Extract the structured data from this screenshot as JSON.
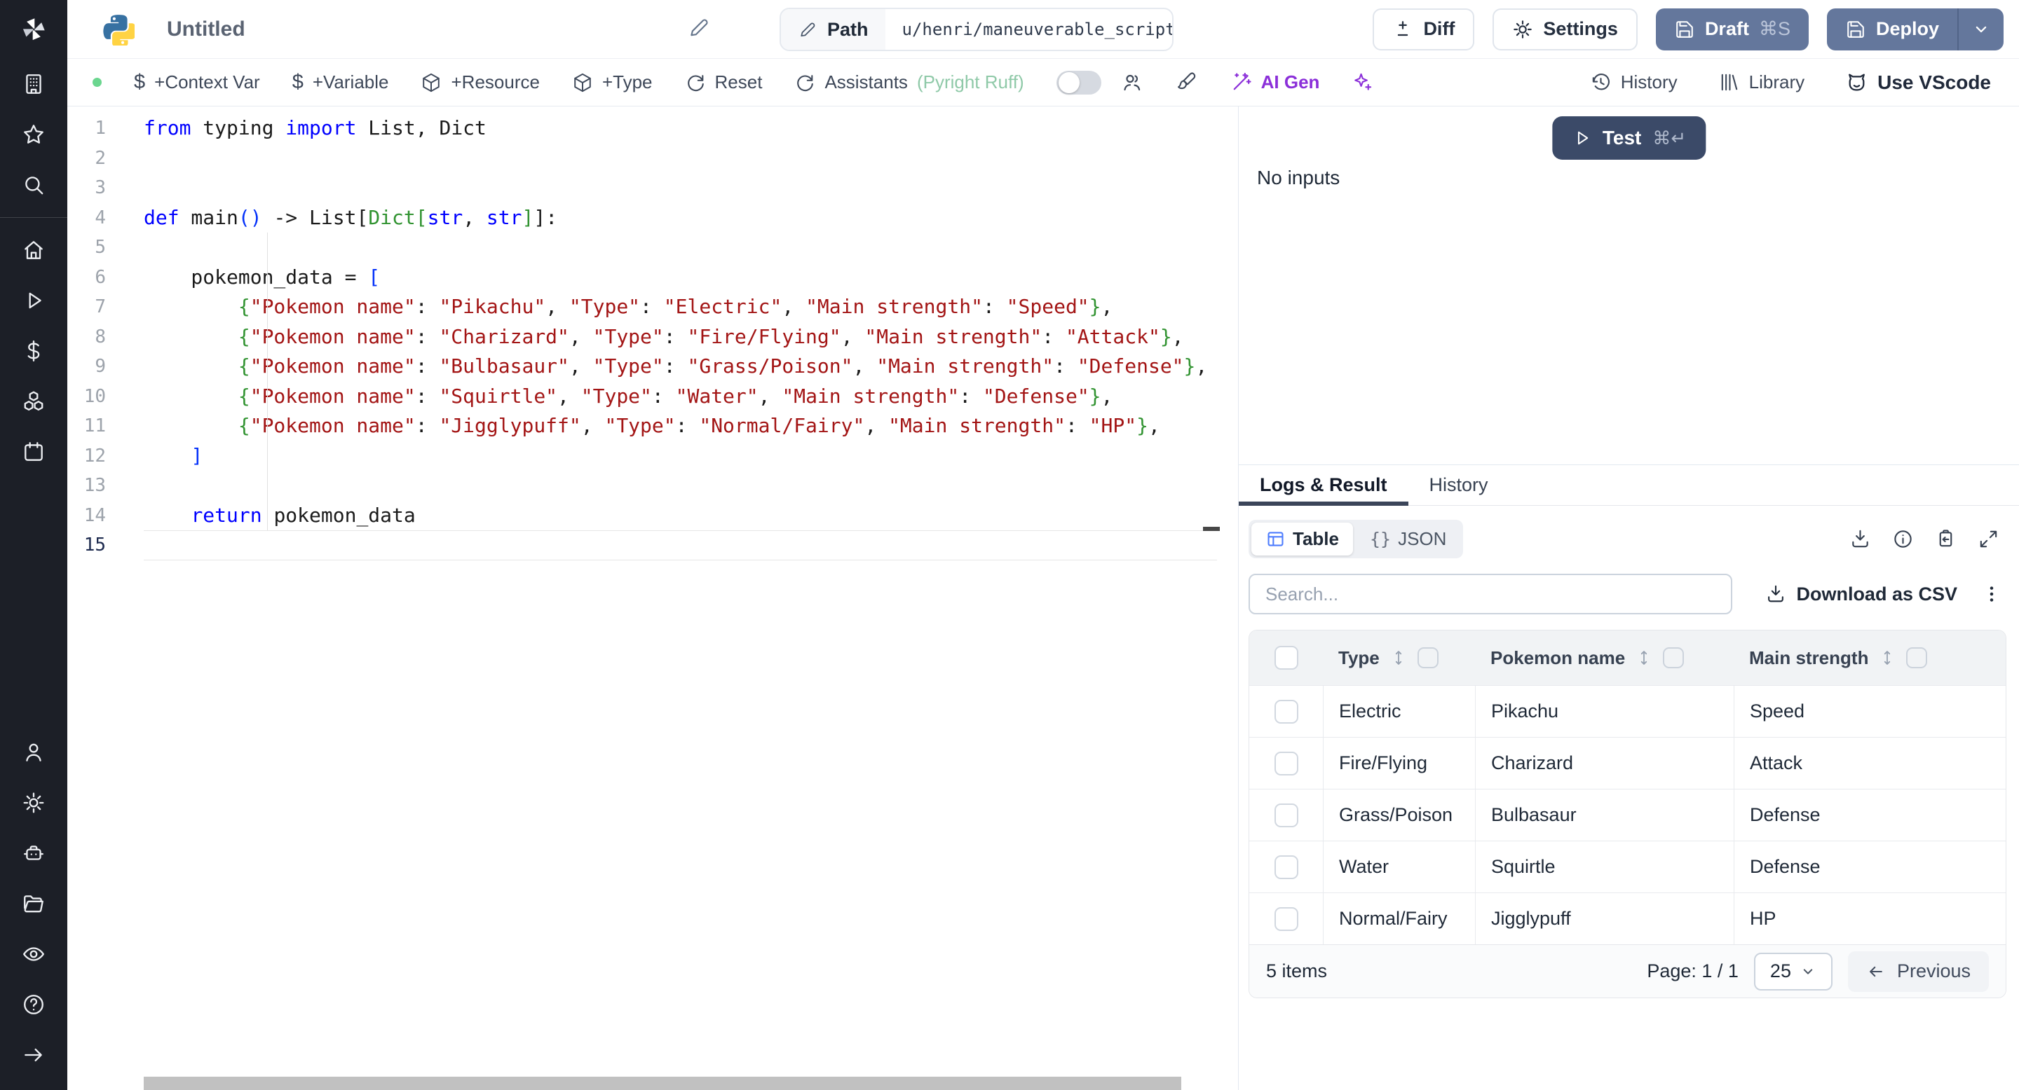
{
  "header": {
    "title": "Untitled",
    "path_label": "Path",
    "path_value": "u/henri/maneuverable_script",
    "buttons": {
      "diff": "Diff",
      "settings": "Settings",
      "draft": "Draft",
      "draft_shortcut": "⌘S",
      "deploy": "Deploy"
    }
  },
  "toolbar": {
    "context_var": "+Context Var",
    "variable": "+Variable",
    "resource": "+Resource",
    "type": "+Type",
    "reset": "Reset",
    "assistants": "Assistants",
    "assistants_detail": "(Pyright Ruff)",
    "ai_gen": "AI Gen",
    "history": "History",
    "library": "Library",
    "use_vscode": "Use VScode"
  },
  "sidebar": {
    "groups": [
      [
        {
          "icon": "building",
          "name": "workspace"
        },
        {
          "icon": "star",
          "name": "favorites"
        },
        {
          "icon": "search",
          "name": "search"
        }
      ],
      [
        {
          "icon": "home",
          "name": "home"
        },
        {
          "icon": "play",
          "name": "runs"
        },
        {
          "icon": "dollar",
          "name": "variables"
        },
        {
          "icon": "boxes",
          "name": "resources"
        },
        {
          "icon": "calendar",
          "name": "schedules"
        }
      ],
      [
        {
          "icon": "user",
          "name": "users"
        },
        {
          "icon": "gear",
          "name": "settings"
        },
        {
          "icon": "bot",
          "name": "workers"
        },
        {
          "icon": "folder",
          "name": "folders"
        },
        {
          "icon": "eye",
          "name": "audit-logs"
        }
      ],
      [
        {
          "icon": "help",
          "name": "help"
        },
        {
          "icon": "arrow-right",
          "name": "expand"
        }
      ]
    ]
  },
  "editor": {
    "lines": [
      [
        [
          "k",
          "from"
        ],
        [
          "d",
          " typing "
        ],
        [
          "k",
          "import"
        ],
        [
          "d",
          " List, Dict"
        ]
      ],
      [],
      [],
      [
        [
          "k",
          "def"
        ],
        [
          "d",
          " main"
        ],
        [
          "b",
          "()"
        ],
        [
          "d",
          " -> List["
        ],
        [
          "g",
          "Dict["
        ],
        [
          "k",
          "str"
        ],
        [
          "d",
          ", "
        ],
        [
          "k",
          "str"
        ],
        [
          "g",
          "]"
        ],
        [
          "d",
          "]:"
        ]
      ],
      [],
      [
        [
          "d",
          "    pokemon_data = "
        ],
        [
          "b",
          "["
        ]
      ],
      [
        [
          "d",
          "        "
        ],
        [
          "g",
          "{"
        ],
        [
          "s",
          "\"Pokemon name\""
        ],
        [
          "d",
          ": "
        ],
        [
          "s",
          "\"Pikachu\""
        ],
        [
          "d",
          ", "
        ],
        [
          "s",
          "\"Type\""
        ],
        [
          "d",
          ": "
        ],
        [
          "s",
          "\"Electric\""
        ],
        [
          "d",
          ", "
        ],
        [
          "s",
          "\"Main strength\""
        ],
        [
          "d",
          ": "
        ],
        [
          "s",
          "\"Speed\""
        ],
        [
          "g",
          "}"
        ],
        [
          "d",
          ","
        ]
      ],
      [
        [
          "d",
          "        "
        ],
        [
          "g",
          "{"
        ],
        [
          "s",
          "\"Pokemon name\""
        ],
        [
          "d",
          ": "
        ],
        [
          "s",
          "\"Charizard\""
        ],
        [
          "d",
          ", "
        ],
        [
          "s",
          "\"Type\""
        ],
        [
          "d",
          ": "
        ],
        [
          "s",
          "\"Fire/Flying\""
        ],
        [
          "d",
          ", "
        ],
        [
          "s",
          "\"Main strength\""
        ],
        [
          "d",
          ": "
        ],
        [
          "s",
          "\"Attack\""
        ],
        [
          "g",
          "}"
        ],
        [
          "d",
          ","
        ]
      ],
      [
        [
          "d",
          "        "
        ],
        [
          "g",
          "{"
        ],
        [
          "s",
          "\"Pokemon name\""
        ],
        [
          "d",
          ": "
        ],
        [
          "s",
          "\"Bulbasaur\""
        ],
        [
          "d",
          ", "
        ],
        [
          "s",
          "\"Type\""
        ],
        [
          "d",
          ": "
        ],
        [
          "s",
          "\"Grass/Poison\""
        ],
        [
          "d",
          ", "
        ],
        [
          "s",
          "\"Main strength\""
        ],
        [
          "d",
          ": "
        ],
        [
          "s",
          "\"Defense\""
        ],
        [
          "g",
          "}"
        ],
        [
          "d",
          ","
        ]
      ],
      [
        [
          "d",
          "        "
        ],
        [
          "g",
          "{"
        ],
        [
          "s",
          "\"Pokemon name\""
        ],
        [
          "d",
          ": "
        ],
        [
          "s",
          "\"Squirtle\""
        ],
        [
          "d",
          ", "
        ],
        [
          "s",
          "\"Type\""
        ],
        [
          "d",
          ": "
        ],
        [
          "s",
          "\"Water\""
        ],
        [
          "d",
          ", "
        ],
        [
          "s",
          "\"Main strength\""
        ],
        [
          "d",
          ": "
        ],
        [
          "s",
          "\"Defense\""
        ],
        [
          "g",
          "}"
        ],
        [
          "d",
          ","
        ]
      ],
      [
        [
          "d",
          "        "
        ],
        [
          "g",
          "{"
        ],
        [
          "s",
          "\"Pokemon name\""
        ],
        [
          "d",
          ": "
        ],
        [
          "s",
          "\"Jigglypuff\""
        ],
        [
          "d",
          ", "
        ],
        [
          "s",
          "\"Type\""
        ],
        [
          "d",
          ": "
        ],
        [
          "s",
          "\"Normal/Fairy\""
        ],
        [
          "d",
          ", "
        ],
        [
          "s",
          "\"Main strength\""
        ],
        [
          "d",
          ": "
        ],
        [
          "s",
          "\"HP\""
        ],
        [
          "g",
          "}"
        ],
        [
          "d",
          ","
        ]
      ],
      [
        [
          "d",
          "    "
        ],
        [
          "b",
          "]"
        ]
      ],
      [],
      [
        [
          "d",
          "    "
        ],
        [
          "k",
          "return"
        ],
        [
          "d",
          " pokemon_data"
        ]
      ],
      []
    ],
    "active_line": 15
  },
  "run": {
    "test_label": "Test",
    "test_shortcut": "⌘↵",
    "no_inputs": "No inputs"
  },
  "results": {
    "tabs": [
      "Logs & Result",
      "History"
    ],
    "view_table": "Table",
    "view_json": "JSON",
    "json_braces": "{}",
    "search_placeholder": "Search...",
    "download_csv": "Download as CSV",
    "table": {
      "columns": [
        "Type",
        "Pokemon name",
        "Main strength"
      ],
      "rows": [
        [
          "Electric",
          "Pikachu",
          "Speed"
        ],
        [
          "Fire/Flying",
          "Charizard",
          "Attack"
        ],
        [
          "Grass/Poison",
          "Bulbasaur",
          "Defense"
        ],
        [
          "Water",
          "Squirtle",
          "Defense"
        ],
        [
          "Normal/Fairy",
          "Jigglypuff",
          "HP"
        ]
      ]
    },
    "footer": {
      "items_count": "5 items",
      "page": "Page: 1 / 1",
      "page_size": "25",
      "previous": "Previous"
    }
  },
  "colors": {
    "accent_slate": "#64779c",
    "test_navy": "#3b4a68",
    "ai_purple": "#8b2fd9",
    "assist_green": "#8fc9a8",
    "status_green": "#6bd68f",
    "table_icon_blue": "#4d7cfe"
  }
}
